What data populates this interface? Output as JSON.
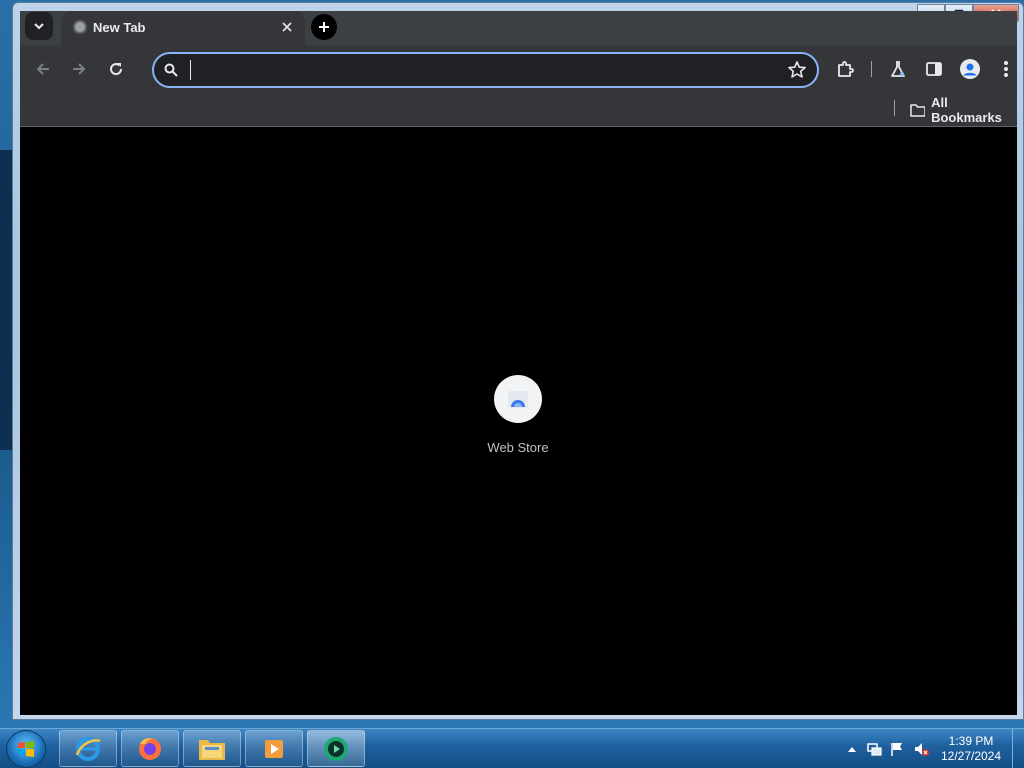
{
  "browser": {
    "tab": {
      "title": "New Tab"
    },
    "omnibox": {
      "value": "",
      "placeholder": ""
    },
    "bookmarks_bar": {
      "all_bookmarks_label": "All Bookmarks"
    },
    "new_tab_page": {
      "shortcuts": [
        {
          "label": "Web Store"
        }
      ]
    }
  },
  "taskbar": {
    "apps": [
      "internet-explorer",
      "firefox",
      "file-explorer",
      "media-player",
      "video-app"
    ],
    "clock": {
      "time": "1:39 PM",
      "date": "12/27/2024"
    }
  },
  "colors": {
    "tabstrip": "#3c4043",
    "toolbar": "#35363a",
    "omnibox_focus": "#8ab4f8",
    "content_bg": "#000000"
  }
}
